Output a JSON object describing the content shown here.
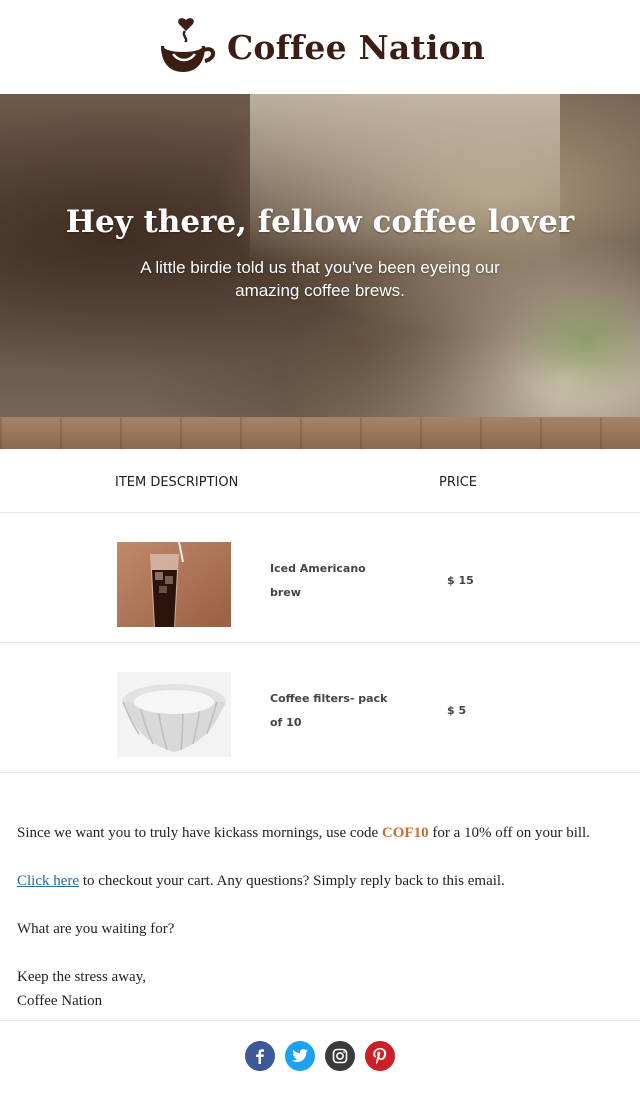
{
  "brand": {
    "name": "Coffee Nation",
    "logo_icon": "coffee-cup-heart-icon",
    "color": "#3b1d14"
  },
  "hero": {
    "title": "Hey there, fellow coffee lover",
    "subtitle": "A little birdie told us that you've been eyeing our amazing coffee brews."
  },
  "table": {
    "col_description": "ITEM DESCRIPTION",
    "col_price": "PRICE",
    "items": [
      {
        "name_line1": "Iced Americano",
        "name_line2": "brew",
        "price": "$ 15",
        "image": "iced-coffee-glass"
      },
      {
        "name_line1": "Coffee filters- pack",
        "name_line2": "of 10",
        "price": "$ 5",
        "image": "paper-coffee-filter"
      }
    ]
  },
  "message": {
    "p1_before": "Since we want you to truly have kickass mornings, use code ",
    "p1_code": "COF10",
    "p1_after": " for a 10% off  on your bill.",
    "p2_link": "Click here",
    "p2_after": " to checkout your cart. Any questions? Simply reply back to this email.",
    "p3": "What are you waiting for?",
    "signoff_line1": "Keep the stress away,",
    "signoff_line2": "Coffee Nation",
    "code_color": "#c8702d",
    "link_color": "#2a6a9a"
  },
  "social": [
    {
      "name": "facebook-icon",
      "color": "#3b5998"
    },
    {
      "name": "twitter-icon",
      "color": "#1da1f2"
    },
    {
      "name": "instagram-icon",
      "color": "#3a3a3a"
    },
    {
      "name": "pinterest-icon",
      "color": "#cb2027"
    }
  ]
}
